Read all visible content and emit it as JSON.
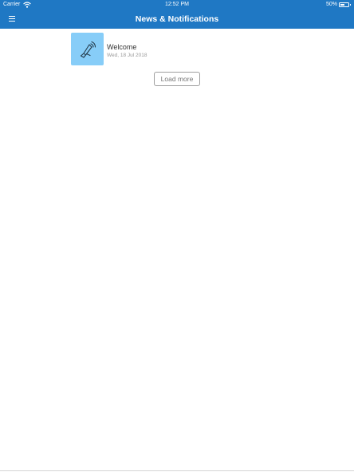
{
  "status_bar": {
    "carrier": "Carrier",
    "time": "12:52 PM",
    "battery_percent": "50%",
    "battery_level": 0.5,
    "wifi_icon": "wifi-icon",
    "battery_icon": "battery-icon"
  },
  "nav": {
    "title": "News & Notifications",
    "menu_icon": "hamburger-menu-icon"
  },
  "news": {
    "items": [
      {
        "title": "Welcome",
        "date": "Wed, 18 Jul 2018",
        "icon": "megaphone-icon",
        "thumb_color": "#87cdf8"
      }
    ],
    "load_more_label": "Load more"
  },
  "colors": {
    "header": "#1f78c4",
    "background": "#ffffff"
  }
}
